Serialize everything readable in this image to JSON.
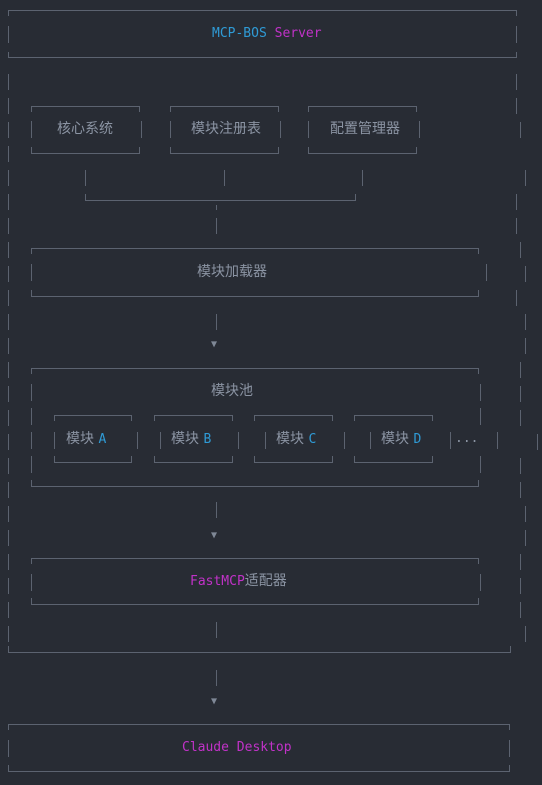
{
  "server": {
    "name": "MCP-BOS",
    "suffix": " Server"
  },
  "top_boxes": [
    "核心系统",
    "模块注册表",
    "配置管理器"
  ],
  "loader": "模块加载器",
  "pool": {
    "title": "模块池",
    "modules": [
      {
        "prefix": "模块 ",
        "letter": "A"
      },
      {
        "prefix": "模块 ",
        "letter": "B"
      },
      {
        "prefix": "模块 ",
        "letter": "C"
      },
      {
        "prefix": "模块 ",
        "letter": "D"
      }
    ],
    "more": "..."
  },
  "adapter": {
    "name": "FastMCP",
    "suffix": "适配器"
  },
  "client": "Claude Desktop",
  "arrow": "▼",
  "colors": {
    "background": "#282c34",
    "line": "#5c6370",
    "accent_blue": "#2f9bd6",
    "accent_magenta": "#c132c8"
  }
}
